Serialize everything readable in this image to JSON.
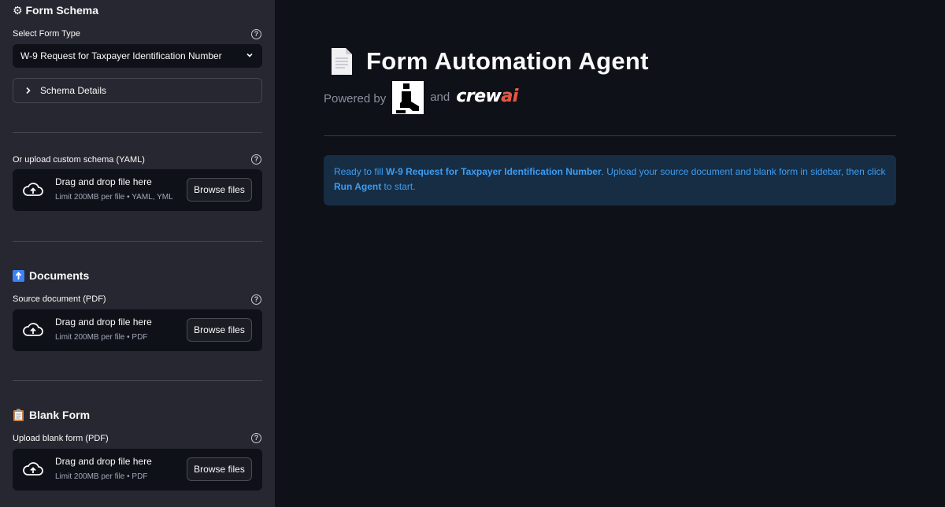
{
  "sidebar": {
    "schema_section": {
      "icon": "gear-icon",
      "title": "⚙ Form Schema"
    },
    "form_type": {
      "label": "Select Form Type",
      "value": "W-9 Request for Taxpayer Identification Number"
    },
    "schema_details": {
      "label": "Schema Details"
    },
    "custom_schema": {
      "label": "Or upload custom schema (YAML)",
      "drag_text": "Drag and drop file here",
      "limit": "Limit 200MB per file • YAML, YML",
      "browse": "Browse files"
    },
    "documents_section": {
      "icon": "upload-arrow-icon",
      "title": "Documents"
    },
    "source_doc": {
      "label": "Source document (PDF)",
      "drag_text": "Drag and drop file here",
      "limit": "Limit 200MB per file • PDF",
      "browse": "Browse files"
    },
    "blank_form_section": {
      "icon": "clipboard-icon",
      "title": "Blank Form"
    },
    "blank_form": {
      "label": "Upload blank form (PDF)",
      "drag_text": "Drag and drop file here",
      "limit": "Limit 200MB per file • PDF",
      "browse": "Browse files"
    }
  },
  "main": {
    "title_icon": "document-icon",
    "title": "Form Automation Agent",
    "powered_by": "Powered by",
    "and": "and",
    "brand_logo_1": "llamaindex-logo",
    "brand_logo_2": "crewai",
    "alert": {
      "prefix": "Ready to fill ",
      "form_name": "W-9 Request for Taxpayer Identification Number",
      "middle": ". Upload your source document and blank form in sidebar, then click ",
      "button_ref": "Run Agent",
      "suffix": " to start."
    }
  },
  "colors": {
    "sidebar_bg": "#262730",
    "main_bg": "#0e1117",
    "alert_bg": "#172d43",
    "alert_text": "#3d9df3",
    "crewai_accent": "#e8523f"
  }
}
